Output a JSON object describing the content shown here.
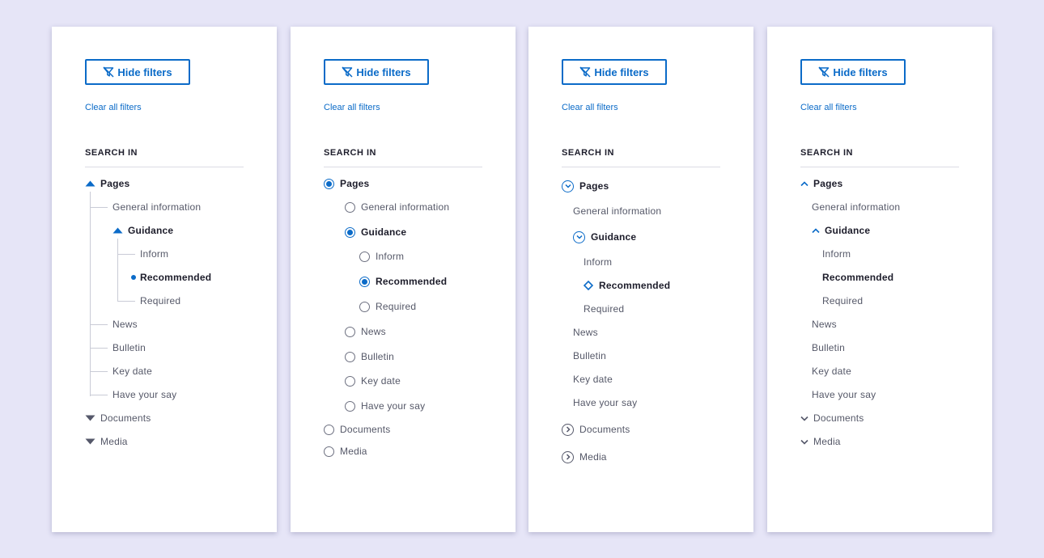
{
  "colors": {
    "accent": "#0b6bc8",
    "background": "#e6e5f7",
    "panel": "#ffffff"
  },
  "panels": [
    {
      "variant": "triangle-tree",
      "hide_filters": "Hide filters",
      "clear_all": "Clear all filters",
      "section_title": "SEARCH IN",
      "items": {
        "pages": "Pages",
        "general": "General information",
        "guidance": "Guidance",
        "inform": "Inform",
        "recommended": "Recommended",
        "required": "Required",
        "news": "News",
        "bulletin": "Bulletin",
        "keydate": "Key date",
        "haveyoursay": "Have your say",
        "documents": "Documents",
        "media": "Media"
      }
    },
    {
      "variant": "radio-list",
      "hide_filters": "Hide filters",
      "clear_all": "Clear all filters",
      "section_title": "SEARCH IN",
      "selected": [
        "Pages",
        "Guidance",
        "Recommended"
      ],
      "items": {
        "pages": "Pages",
        "general": "General information",
        "guidance": "Guidance",
        "inform": "Inform",
        "recommended": "Recommended",
        "required": "Required",
        "news": "News",
        "bulletin": "Bulletin",
        "keydate": "Key date",
        "haveyoursay": "Have your say",
        "documents": "Documents",
        "media": "Media"
      }
    },
    {
      "variant": "circled-chevrons",
      "hide_filters": "Hide filters",
      "clear_all": "Clear all filters",
      "section_title": "SEARCH IN",
      "items": {
        "pages": "Pages",
        "general": "General information",
        "guidance": "Guidance",
        "inform": "Inform",
        "recommended": "Recommended",
        "required": "Required",
        "news": "News",
        "bulletin": "Bulletin",
        "keydate": "Key date",
        "haveyoursay": "Have your say",
        "documents": "Documents",
        "media": "Media"
      }
    },
    {
      "variant": "chevron-list",
      "hide_filters": "Hide filters",
      "clear_all": "Clear all filters",
      "section_title": "SEARCH IN",
      "items": {
        "pages": "Pages",
        "general": "General information",
        "guidance": "Guidance",
        "inform": "Inform",
        "recommended": "Recommended",
        "required": "Required",
        "news": "News",
        "bulletin": "Bulletin",
        "keydate": "Key date",
        "haveyoursay": "Have your say",
        "documents": "Documents",
        "media": "Media"
      }
    }
  ]
}
